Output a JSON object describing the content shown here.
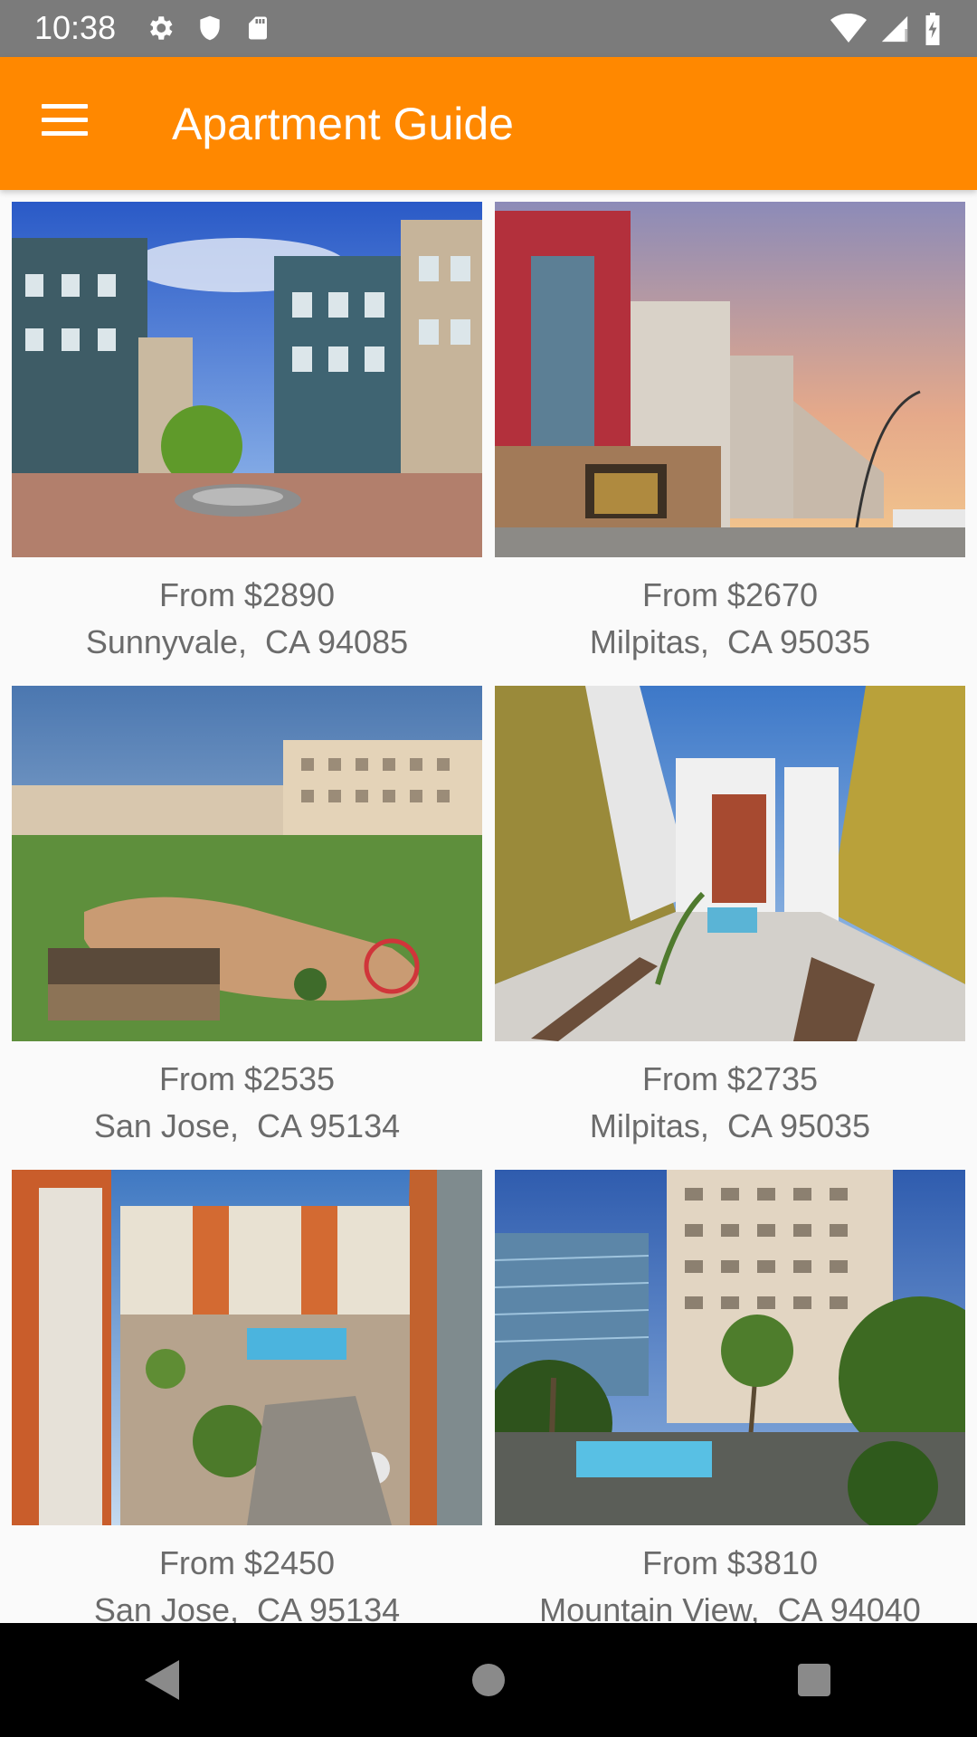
{
  "status_bar": {
    "time": "10:38",
    "left_icons": [
      "settings-icon",
      "shield-icon",
      "sd-card-icon"
    ],
    "right_icons": [
      "wifi-icon",
      "signal-icon",
      "battery-icon"
    ]
  },
  "app_bar": {
    "title": "Apartment Guide",
    "menu_icon": "menu-icon",
    "background": "#ff8800"
  },
  "listings": [
    {
      "price": "From $2890",
      "location": "Sunnyvale,  CA 94085",
      "photo": "apartment building with plaza and fountain"
    },
    {
      "price": "From $2670",
      "location": "Milpitas,  CA 95035",
      "photo": "modern building with red facade at sunset"
    },
    {
      "price": "From $2535",
      "location": "San Jose,  CA 95134",
      "photo": "aerial view of park and playground"
    },
    {
      "price": "From $2735",
      "location": "Milpitas,  CA 95035",
      "photo": "courtyard with pool between buildings"
    },
    {
      "price": "From $2450",
      "location": "San Jose,  CA 95134",
      "photo": "orange building courtyard with pool"
    },
    {
      "price": "From $3810",
      "location": "Mountain View,  CA 94040",
      "photo": "high-rise with palm trees and pool"
    }
  ],
  "nav_bar": {
    "buttons": [
      "back-icon",
      "home-icon",
      "recents-icon"
    ]
  }
}
